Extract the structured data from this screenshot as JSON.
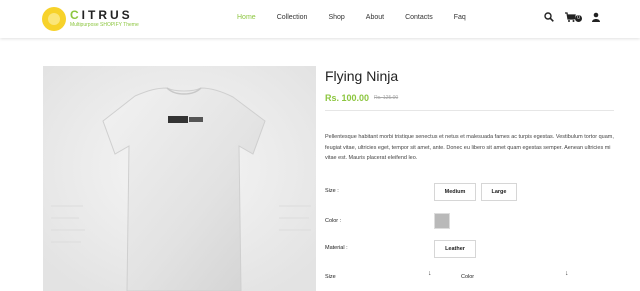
{
  "brand": {
    "name": "CITRUS",
    "tagline": "Multipurpose SHOPIFY Theme",
    "accent": "#8cc63f",
    "logo_color": "#f7d22a"
  },
  "nav": {
    "items": [
      {
        "label": "Home",
        "active": true
      },
      {
        "label": "Collection"
      },
      {
        "label": "Shop"
      },
      {
        "label": "About"
      },
      {
        "label": "Contacts"
      },
      {
        "label": "Faq"
      }
    ]
  },
  "header_icons": {
    "search": "search-icon",
    "cart": "cart-icon",
    "cart_count": "0",
    "account": "user-icon"
  },
  "product": {
    "title": "Flying Ninja",
    "price": "Rs. 100.00",
    "old_price": "Rs. 125.00",
    "description": "Pellentesque habitant morbi tristique senectus et netus et malesuada fames ac turpis egestas. Vestibulum tortor quam, feugiat vitae, ultricies eget, tempor sit amet, ante. Donec eu libero sit amet quam egestas semper. Aenean ultricies mi vitae est. Mauris placerat eleifend leo.",
    "image_label": "t-shirt-back-image"
  },
  "options": {
    "size": {
      "label": "Size :",
      "values": [
        "Medium",
        "Large"
      ]
    },
    "color": {
      "label": "Color :",
      "swatch": "#b9b9b9"
    },
    "material": {
      "label": "Material :",
      "values": [
        "Leather"
      ]
    }
  },
  "selects": {
    "size_label": "Size",
    "color_label": "Color",
    "arrow": "↓"
  }
}
